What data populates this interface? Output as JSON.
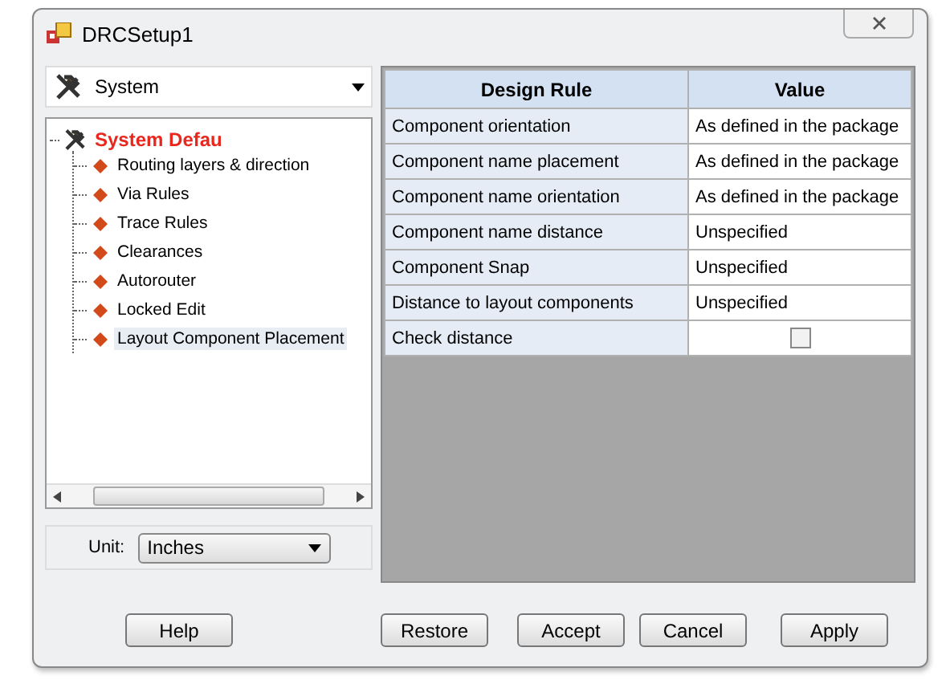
{
  "window": {
    "title": "DRCSetup1"
  },
  "rule_set_dropdown": {
    "value": "System"
  },
  "tree": {
    "label": "System Defau",
    "children": [
      {
        "label": "Routing layers & direction",
        "selected": false
      },
      {
        "label": "Via Rules",
        "selected": false
      },
      {
        "label": "Trace Rules",
        "selected": false
      },
      {
        "label": "Clearances",
        "selected": false
      },
      {
        "label": "Autorouter",
        "selected": false
      },
      {
        "label": "Locked Edit",
        "selected": false
      },
      {
        "label": "Layout Component Placement",
        "selected": true
      }
    ]
  },
  "unit": {
    "label": "Unit:",
    "value": "Inches"
  },
  "table": {
    "columns": [
      "Design Rule",
      "Value"
    ],
    "rows": [
      {
        "rule": "Component orientation",
        "kind": "text",
        "value": "As defined in the package"
      },
      {
        "rule": "Component name placement",
        "kind": "text",
        "value": "As defined in the package"
      },
      {
        "rule": "Component name orientation",
        "kind": "text",
        "value": "As defined in the package"
      },
      {
        "rule": "Component name distance",
        "kind": "text",
        "value": "Unspecified"
      },
      {
        "rule": "Component Snap",
        "kind": "text",
        "value": "Unspecified"
      },
      {
        "rule": "Distance to layout components",
        "kind": "text",
        "value": "Unspecified"
      },
      {
        "rule": "Check distance",
        "kind": "checkbox",
        "checked": false
      }
    ]
  },
  "buttons": [
    "Help",
    "Restore",
    "Accept",
    "Cancel",
    "Apply"
  ]
}
